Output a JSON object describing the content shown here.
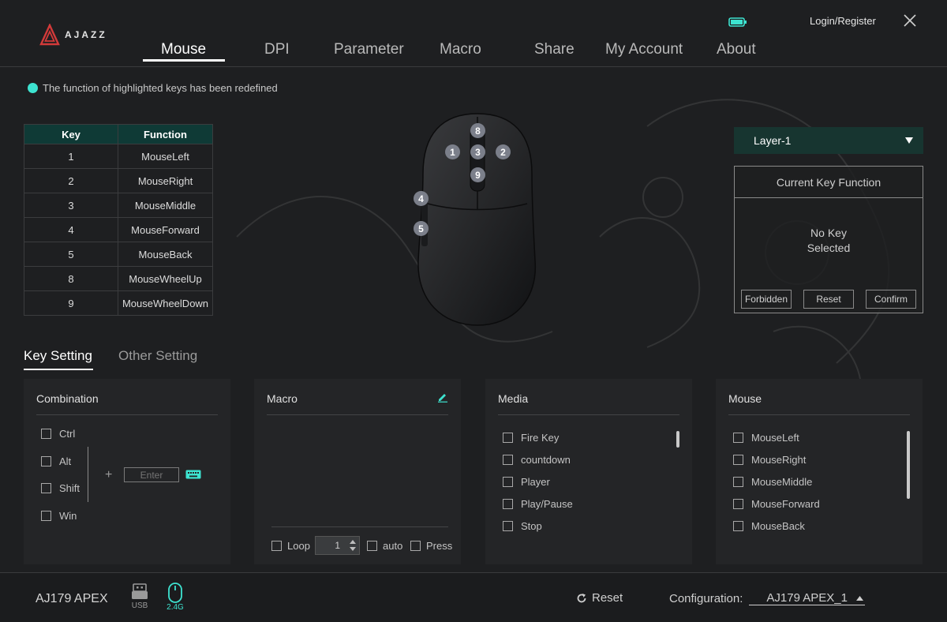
{
  "app": {
    "logo_text": "AJAZZ",
    "login": "Login/Register"
  },
  "nav": {
    "items": [
      "Mouse",
      "DPI",
      "Parameter",
      "Macro",
      "Share",
      "My Account",
      "About"
    ],
    "active": "Mouse"
  },
  "notice": "The function of highlighted keys has been redefined",
  "key_table": {
    "headers": [
      "Key",
      "Function"
    ],
    "rows": [
      [
        "1",
        "MouseLeft"
      ],
      [
        "2",
        "MouseRight"
      ],
      [
        "3",
        "MouseMiddle"
      ],
      [
        "4",
        "MouseForward"
      ],
      [
        "5",
        "MouseBack"
      ],
      [
        "8",
        "MouseWheelUp"
      ],
      [
        "9",
        "MouseWheelDown"
      ]
    ]
  },
  "mouse_keys": [
    "8",
    "1",
    "3",
    "2",
    "9",
    "4",
    "5"
  ],
  "layer": {
    "selected": "Layer-1"
  },
  "current_key": {
    "title": "Current Key Function",
    "body_line1": "No Key",
    "body_line2": "Selected",
    "buttons": [
      "Forbidden",
      "Reset",
      "Confirm"
    ]
  },
  "subtabs": {
    "key_setting": "Key Setting",
    "other_setting": "Other Setting"
  },
  "combination": {
    "title": "Combination",
    "modifiers": [
      "Ctrl",
      "Alt",
      "Shift",
      "Win"
    ],
    "plus": "+",
    "input_placeholder": "Enter"
  },
  "macro": {
    "title": "Macro",
    "loop": "Loop",
    "loop_value": "1",
    "auto": "auto",
    "press": "Press"
  },
  "media": {
    "title": "Media",
    "items": [
      "Fire Key",
      "countdown",
      "Player",
      "Play/Pause",
      "Stop"
    ]
  },
  "mouse_panel": {
    "title": "Mouse",
    "items": [
      "MouseLeft",
      "MouseRight",
      "MouseMiddle",
      "MouseForward",
      "MouseBack"
    ]
  },
  "bottom": {
    "device": "AJ179 APEX",
    "usb": "USB",
    "wireless": "2.4G",
    "reset": "Reset",
    "config_label": "Configuration:",
    "config_value": "AJ179 APEX_1"
  },
  "colors": {
    "accent": "#3de3d0",
    "layer_bg": "#173530",
    "table_header": "#0f3a36"
  }
}
